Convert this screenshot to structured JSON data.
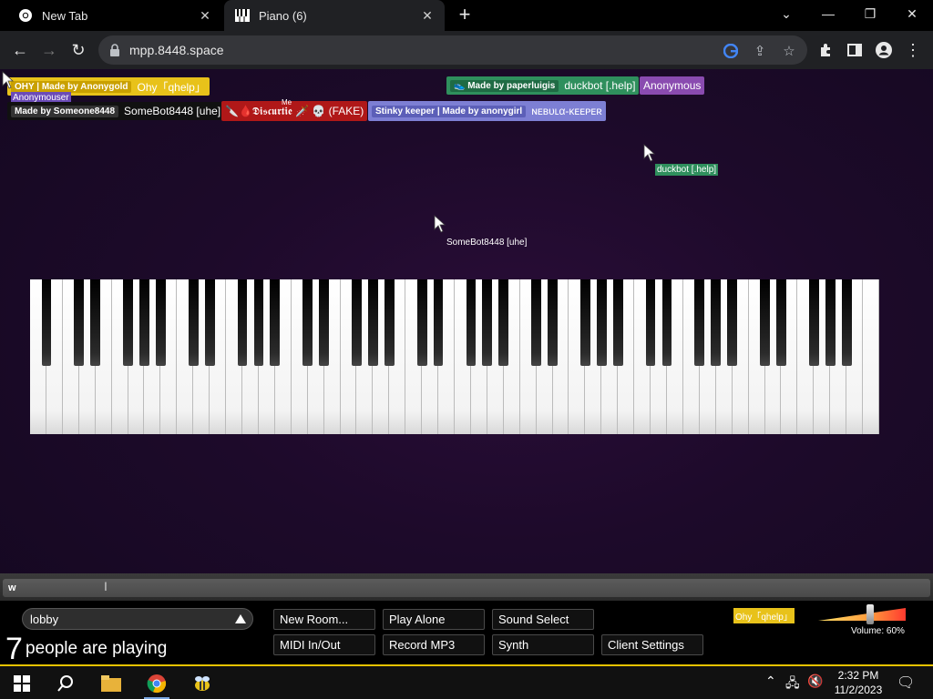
{
  "browser": {
    "tabs": [
      {
        "title": "New Tab",
        "active": false
      },
      {
        "title": "Piano (6)",
        "active": true
      }
    ],
    "url": "mpp.8448.space"
  },
  "piano_page": {
    "namebadges": {
      "n1_tag": "ОНY | Made by Anonygold",
      "n1_name": "Ohy「qhelp」",
      "n2_name": "Anonymous",
      "n3_tag": "Made by Someone8448",
      "n3_name": "SomeBot8448 [uhe]",
      "n4_me": "Me",
      "n4_name": "🔪🩸𝕯𝖎𝖘𝖈𝖚𝖗𝖙𝖎𝖊 🗡️ 💀 (FAKE)",
      "n5_tag": "👟 Made by paperluigis",
      "n5_name": "duckbot [.help]",
      "n6_name": "Anonymous",
      "n7_tag": "Stinky keeper | Made by anonygirl",
      "n7_name": "ɴᴇʙᴜʟα-ᴋᴇᴇᴘᴇʀ"
    },
    "cursors": {
      "c_anon": "Anonymouser",
      "c_duck": "duckbot [.help]",
      "c_somebot": "SomeBot8448 [uhe]",
      "c_ohy": "Ohy「qhelp」"
    },
    "chat_input": "w",
    "room": "lobby",
    "player_count": "7",
    "player_text": "people are playing",
    "buttons": {
      "new_room": "New Room...",
      "play_alone": "Play Alone",
      "sound_select": "Sound Select",
      "midi": "MIDI In/Out",
      "record": "Record MP3",
      "synth": "Synth",
      "client_settings": "Client Settings"
    },
    "volume": {
      "label": "Volume: 60%",
      "level": 0.6
    }
  },
  "taskbar": {
    "time": "2:32 PM",
    "date": "11/2/2023"
  },
  "colors": {
    "ohy": "#e8c21a",
    "duckbot": "#2f8f5d",
    "anonymous_purple": "#8a4bb0",
    "discurtie": "#b01818",
    "nebula": "#7d7fd4",
    "accent_taskbar": "#e6c200"
  }
}
